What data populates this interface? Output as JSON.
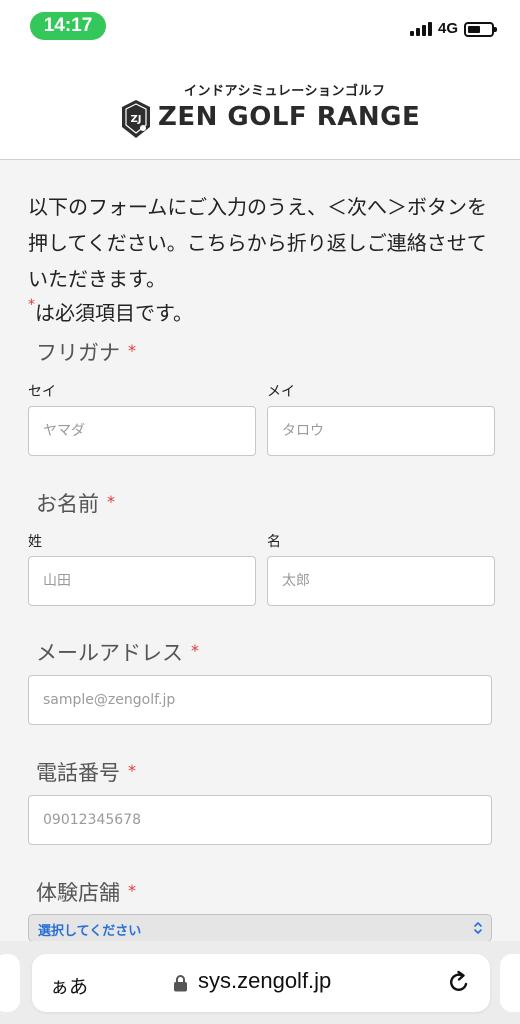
{
  "status": {
    "time": "14:17",
    "network": "4G",
    "icons": [
      "signal-icon",
      "battery-icon"
    ]
  },
  "header": {
    "tagline": "インドアシミュレーションゴルフ",
    "brand": "ZEN GOLF RANGE",
    "logo_icon": "zen-logo-icon"
  },
  "form": {
    "intro": "以下のフォームにご入力のうえ、＜次へ＞ボタンを押してください。こちらから折り返しご連絡させていただきます。",
    "required_star": "*",
    "required_note": "は必須項目です。",
    "sections": {
      "furigana": {
        "label": "フリガナ",
        "sei_label": "セイ",
        "sei_placeholder": "ヤマダ",
        "mei_label": "メイ",
        "mei_placeholder": "タロウ"
      },
      "name": {
        "label": "お名前",
        "sei_label": "姓",
        "sei_placeholder": "山田",
        "mei_label": "名",
        "mei_placeholder": "太郎"
      },
      "email": {
        "label": "メールアドレス",
        "placeholder": "sample@zengolf.jp"
      },
      "phone": {
        "label": "電話番号",
        "placeholder": "09012345678"
      },
      "store": {
        "label": "体験店舗",
        "selected": "選択してください"
      }
    },
    "colors": {
      "required": "#e03a3a",
      "select_text": "#2a6fd6",
      "status_pill": "#34c759"
    }
  },
  "browser": {
    "aa_label": "ぁあ",
    "url": "sys.zengolf.jp",
    "icons": [
      "lock-icon",
      "reload-icon"
    ]
  }
}
